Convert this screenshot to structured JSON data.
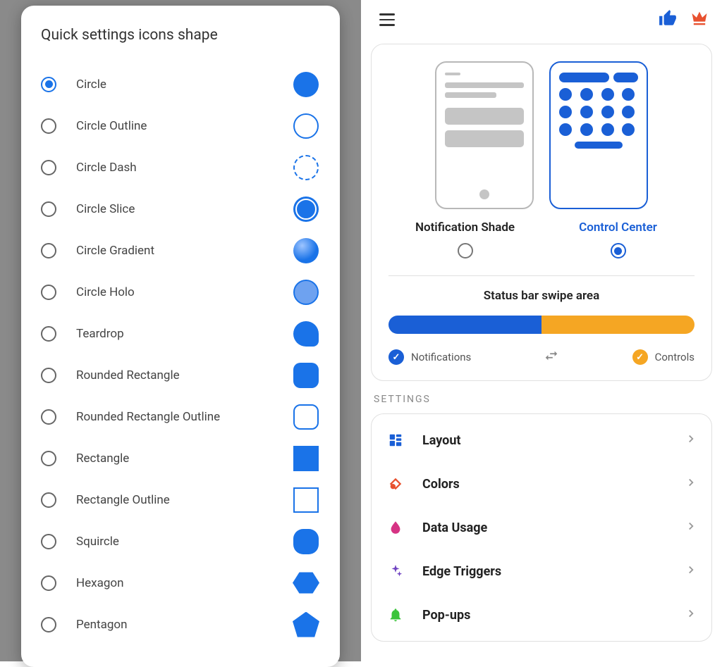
{
  "left": {
    "title": "Quick settings icons shape",
    "selected": 0,
    "shapes": [
      {
        "label": "Circle",
        "preview": "circle-fill"
      },
      {
        "label": "Circle Outline",
        "preview": "circle-outline"
      },
      {
        "label": "Circle Dash",
        "preview": "circle-dash"
      },
      {
        "label": "Circle Slice",
        "preview": "circle-slice"
      },
      {
        "label": "Circle Gradient",
        "preview": "circle-gradient"
      },
      {
        "label": "Circle Holo",
        "preview": "circle-holo"
      },
      {
        "label": "Teardrop",
        "preview": "teardrop"
      },
      {
        "label": "Rounded Rectangle",
        "preview": "rrect"
      },
      {
        "label": "Rounded Rectangle Outline",
        "preview": "rrect-outline"
      },
      {
        "label": "Rectangle",
        "preview": "rect"
      },
      {
        "label": "Rectangle Outline",
        "preview": "rect-outline"
      },
      {
        "label": "Squircle",
        "preview": "squircle"
      },
      {
        "label": "Hexagon",
        "preview": "hexagon"
      },
      {
        "label": "Pentagon",
        "preview": "pentagon"
      }
    ]
  },
  "right": {
    "modes": {
      "notification": "Notification Shade",
      "control": "Control Center",
      "active": "control"
    },
    "swipe": {
      "title": "Status bar swipe area",
      "left_label": "Notifications",
      "right_label": "Controls"
    },
    "section_label": "SETTINGS",
    "settings": [
      {
        "label": "Layout",
        "icon": "layout",
        "color": "#1a5fd6"
      },
      {
        "label": "Colors",
        "icon": "colors",
        "color": "#e8512f"
      },
      {
        "label": "Data Usage",
        "icon": "drop",
        "color": "#d63384"
      },
      {
        "label": "Edge Triggers",
        "icon": "sparkle",
        "color": "#6f42c1"
      },
      {
        "label": "Pop-ups",
        "icon": "bell",
        "color": "#3bc43b"
      }
    ]
  }
}
